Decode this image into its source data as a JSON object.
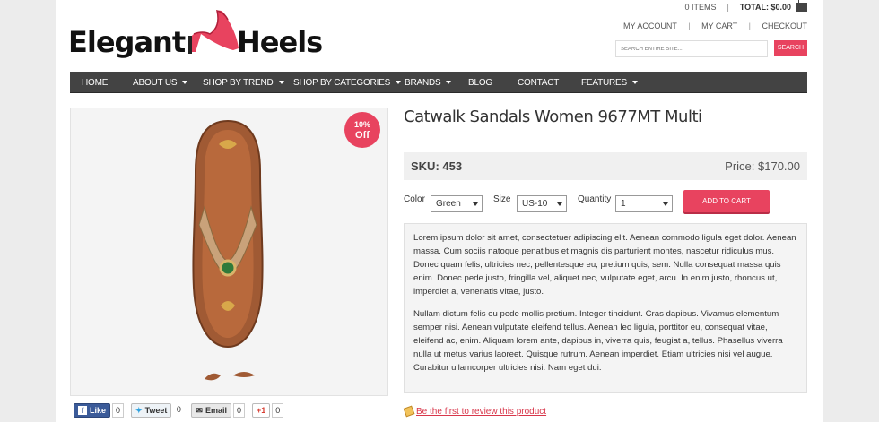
{
  "brand": {
    "logo_word_1": "Elegant",
    "logo_word_2": "Heels"
  },
  "header": {
    "items_count": "0 ITEMS",
    "total_label": "TOTAL: $0.00",
    "links": [
      "MY ACCOUNT",
      "MY CART",
      "CHECKOUT"
    ],
    "search_placeholder": "SEARCH ENTIRE SITE...",
    "search_button": "SEARCH"
  },
  "nav": {
    "items": [
      {
        "label": "HOME",
        "dropdown": false
      },
      {
        "label": "ABOUT US",
        "dropdown": true
      },
      {
        "label": "SHOP BY TREND",
        "dropdown": true
      },
      {
        "label": "SHOP BY CATEGORIES",
        "dropdown": true
      },
      {
        "label": "BRANDS",
        "dropdown": true
      },
      {
        "label": "BLOG",
        "dropdown": false
      },
      {
        "label": "CONTACT",
        "dropdown": false
      },
      {
        "label": "FEATURES",
        "dropdown": true
      }
    ]
  },
  "product": {
    "badge_pct": "10%",
    "badge_off": "Off",
    "title": "Catwalk Sandals Women 9677MT Multi",
    "sku_label": "SKU: ",
    "sku_value": "453",
    "price": "Price: $170.00",
    "options": {
      "color_label": "Color",
      "color_value": "Green",
      "size_label": "Size",
      "size_value": "US-10",
      "qty_label": "Quantity",
      "qty_value": "1"
    },
    "add_to_cart": "ADD TO CART",
    "description": [
      "Lorem ipsum dolor sit amet, consectetuer adipiscing elit. Aenean commodo ligula eget dolor. Aenean massa. Cum sociis natoque penatibus et magnis dis parturient montes, nascetur ridiculus mus. Donec quam felis, ultricies nec, pellentesque eu, pretium quis, sem. Nulla consequat massa quis enim. Donec pede justo, fringilla vel, aliquet nec, vulputate eget, arcu. In enim justo, rhoncus ut, imperdiet a, venenatis vitae, justo.",
      "Nullam dictum felis eu pede mollis pretium. Integer tincidunt. Cras dapibus. Vivamus elementum semper nisi. Aenean vulputate eleifend tellus. Aenean leo ligula, porttitor eu, consequat vitae, eleifend ac, enim. Aliquam lorem ante, dapibus in, viverra quis, feugiat a, tellus. Phasellus viverra nulla ut metus varius laoreet. Quisque rutrum. Aenean imperdiet. Etiam ultricies nisi vel augue. Curabitur ullamcorper ultricies nisi. Nam eget dui."
    ],
    "review_link": "Be the first to review this product"
  },
  "share": {
    "like": "Like",
    "like_count": "0",
    "tweet": "Tweet",
    "tweet_count": "0",
    "email": "Email",
    "email_count": "0",
    "gplus": "+1",
    "gplus_count": "0"
  },
  "colors": {
    "accent": "#e8435f",
    "nav_bg": "#434343"
  }
}
